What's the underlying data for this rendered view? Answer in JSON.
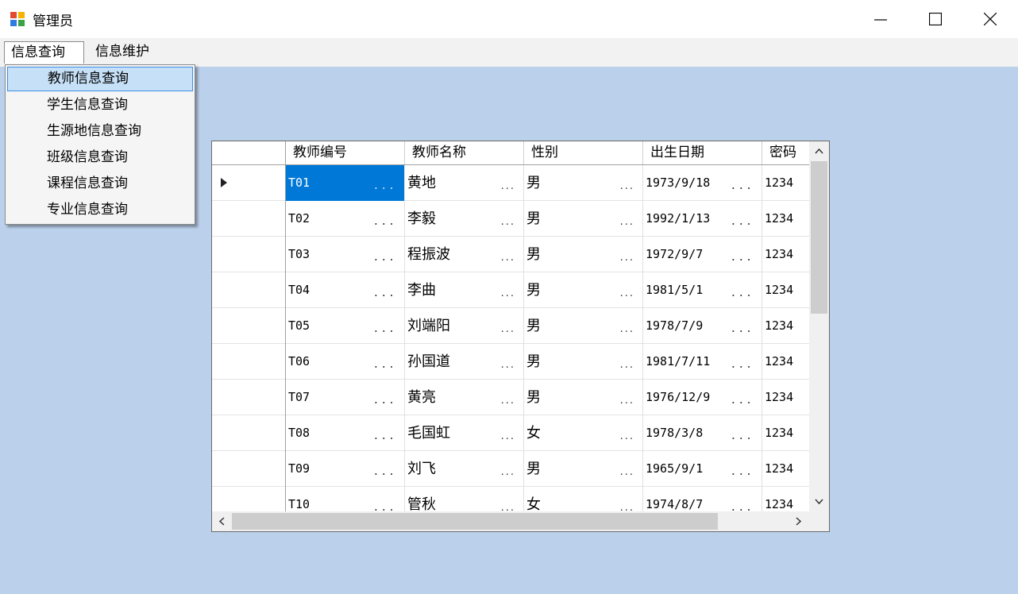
{
  "window": {
    "title": "管理员"
  },
  "menu": {
    "items": [
      {
        "label": "信息查询"
      },
      {
        "label": "信息维护"
      }
    ],
    "dropdown": [
      {
        "label": "教师信息查询"
      },
      {
        "label": "学生信息查询"
      },
      {
        "label": "生源地信息查询"
      },
      {
        "label": "班级信息查询"
      },
      {
        "label": "课程信息查询"
      },
      {
        "label": "专业信息查询"
      }
    ]
  },
  "grid": {
    "columns": [
      "教师编号",
      "教师名称",
      "性别",
      "出生日期",
      "密码"
    ],
    "ellipsis": "...",
    "rows": [
      {
        "id": "T01",
        "name": "黄地",
        "gender": "男",
        "birth": "1973/9/18",
        "pwd": "1234"
      },
      {
        "id": "T02",
        "name": "李毅",
        "gender": "男",
        "birth": "1992/1/13",
        "pwd": "1234"
      },
      {
        "id": "T03",
        "name": "程振波",
        "gender": "男",
        "birth": "1972/9/7",
        "pwd": "1234"
      },
      {
        "id": "T04",
        "name": "李曲",
        "gender": "男",
        "birth": "1981/5/1",
        "pwd": "1234"
      },
      {
        "id": "T05",
        "name": "刘端阳",
        "gender": "男",
        "birth": "1978/7/9",
        "pwd": "1234"
      },
      {
        "id": "T06",
        "name": "孙国道",
        "gender": "男",
        "birth": "1981/7/11",
        "pwd": "1234"
      },
      {
        "id": "T07",
        "name": "黄亮",
        "gender": "男",
        "birth": "1976/12/9",
        "pwd": "1234"
      },
      {
        "id": "T08",
        "name": "毛国虹",
        "gender": "女",
        "birth": "1978/3/8",
        "pwd": "1234"
      },
      {
        "id": "T09",
        "name": "刘飞",
        "gender": "男",
        "birth": "1965/9/1",
        "pwd": "1234"
      },
      {
        "id": "T10",
        "name": "管秋",
        "gender": "女",
        "birth": "1974/8/7",
        "pwd": "1234"
      }
    ]
  },
  "colors": {
    "background": "#bbd0ea",
    "selection": "#0078d7",
    "highlight": "#c6e0f7"
  }
}
